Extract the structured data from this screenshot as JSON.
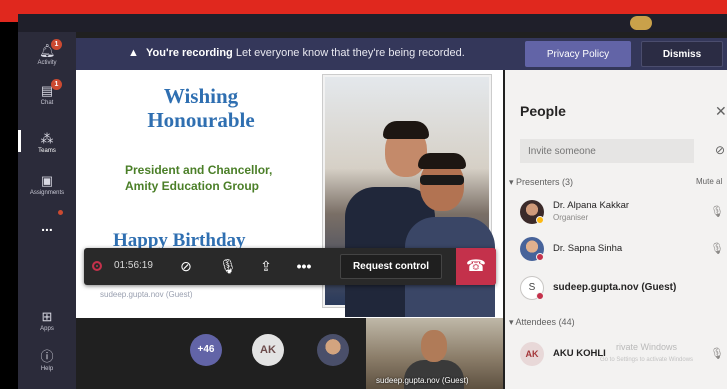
{
  "rail": {
    "items": [
      {
        "label": "Activity",
        "badge": "1"
      },
      {
        "label": "Chat",
        "badge": "1"
      },
      {
        "label": "Teams"
      },
      {
        "label": "Assignments"
      },
      {
        "label": "..."
      },
      {
        "label": "Apps"
      },
      {
        "label": "Help"
      }
    ]
  },
  "banner": {
    "bold_text": "You're recording",
    "text": "Let everyone know that they're being recorded.",
    "privacy_label": "Privacy Policy",
    "dismiss_label": "Dismiss"
  },
  "slide": {
    "title_line1": "Wishing",
    "title_line2": "Honourable",
    "subtitle_line1": "President and Chancellor,",
    "subtitle_line2": "Amity Education Group",
    "birthday": "Happy Birthday",
    "sharer_name": "sudeep.gupta.nov (Guest)"
  },
  "controls": {
    "timer": "01:56:19",
    "request_control_label": "Request control"
  },
  "bottom": {
    "overflow_count": "+46",
    "ak_initials": "AK",
    "video_name": "sudeep.gupta.nov (Guest)"
  },
  "people": {
    "title": "People",
    "invite_placeholder": "Invite someone",
    "presenters_label": "Presenters (3)",
    "mute_all_label": "Mute al",
    "attendees_label": "Attendees (44)",
    "presenters": [
      {
        "name": "Dr. Alpana Kakkar",
        "role": "Organiser"
      },
      {
        "name": "Dr. Sapna Sinha"
      },
      {
        "name": "sudeep.gupta.nov (Guest)",
        "initial": "S"
      }
    ],
    "attendees": [
      {
        "name": "AKU KOHLI",
        "initials": "AK"
      }
    ],
    "watermark_title": "rivate Windows",
    "watermark_sub": "Go to Settings to activate Windows"
  }
}
